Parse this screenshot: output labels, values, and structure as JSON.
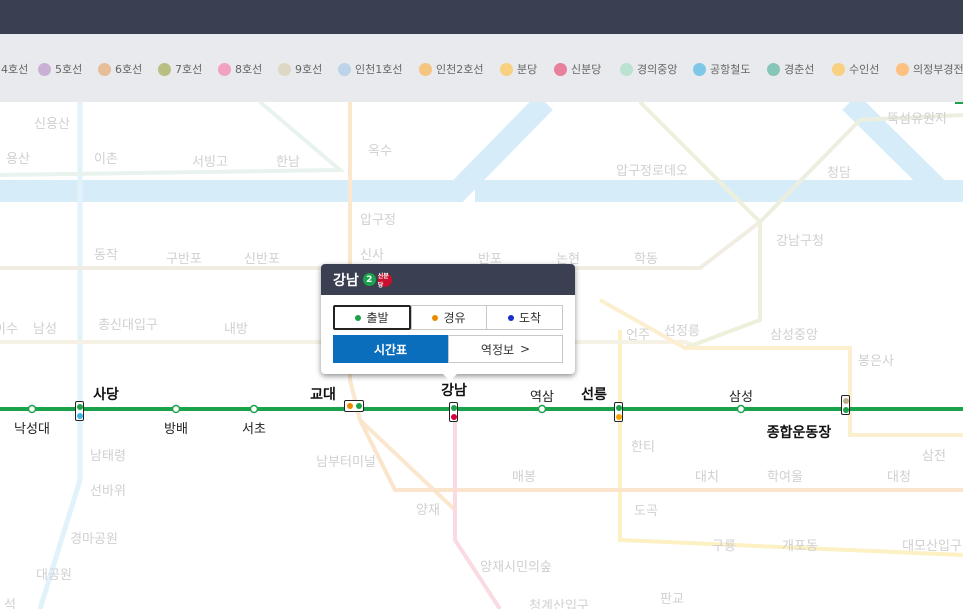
{
  "legend": [
    {
      "label": "4호선",
      "color": "#3cb4e5"
    },
    {
      "label": "5호선",
      "color": "#996cac",
      "num": "5"
    },
    {
      "label": "6호선",
      "color": "#cd7c2f",
      "num": "6"
    },
    {
      "label": "7호선",
      "color": "#747f00",
      "num": "7"
    },
    {
      "label": "8호선",
      "color": "#e6186c",
      "num": "8"
    },
    {
      "label": "9호선",
      "color": "#bdb092",
      "num": "9"
    },
    {
      "label": "인천1호선",
      "color": "#7ca8d5",
      "num": "I"
    },
    {
      "label": "인천2호선",
      "color": "#ed8b00",
      "num": "2"
    },
    {
      "label": "분당",
      "color": "#f5a200",
      "num": "분당"
    },
    {
      "label": "신분당",
      "color": "#d4003b",
      "num": "신분당"
    },
    {
      "label": "경의중앙",
      "color": "#77c4a3",
      "num": "경"
    },
    {
      "label": "공항철도",
      "color": "#0090d2",
      "num": "공"
    },
    {
      "label": "경춘선",
      "color": "#0c8e72",
      "num": "경"
    },
    {
      "label": "수인선",
      "color": "#f5a200",
      "num": "수"
    },
    {
      "label": "의정부경전",
      "color": "#fd8100",
      "num": "의"
    }
  ],
  "stations_faded": [
    {
      "name": "신용산"
    },
    {
      "name": "용산"
    },
    {
      "name": "이촌"
    },
    {
      "name": "서빙고"
    },
    {
      "name": "한남"
    },
    {
      "name": "옥수"
    },
    {
      "name": "압구정로데오"
    },
    {
      "name": "청담"
    },
    {
      "name": "뚝섬유원지"
    },
    {
      "name": "압구정"
    },
    {
      "name": "강남구청"
    },
    {
      "name": "동작"
    },
    {
      "name": "구반포"
    },
    {
      "name": "신반포"
    },
    {
      "name": "신사"
    },
    {
      "name": "반포"
    },
    {
      "name": "논현"
    },
    {
      "name": "학동"
    },
    {
      "name": "이수"
    },
    {
      "name": "남성"
    },
    {
      "name": "총신대입구"
    },
    {
      "name": "내방"
    },
    {
      "name": "언주"
    },
    {
      "name": "선정릉"
    },
    {
      "name": "삼성중앙"
    },
    {
      "name": "봉은사"
    },
    {
      "name": "남태령"
    },
    {
      "name": "선바위"
    },
    {
      "name": "경마공원"
    },
    {
      "name": "대공원"
    },
    {
      "name": "남부터미널"
    },
    {
      "name": "양재"
    },
    {
      "name": "양재시민의숲"
    },
    {
      "name": "청계산입구"
    },
    {
      "name": "매봉"
    },
    {
      "name": "한티"
    },
    {
      "name": "대치"
    },
    {
      "name": "학여울"
    },
    {
      "name": "대청"
    },
    {
      "name": "삼전"
    },
    {
      "name": "도곡"
    },
    {
      "name": "구룡"
    },
    {
      "name": "개포동"
    },
    {
      "name": "대모산입구"
    },
    {
      "name": "판교"
    },
    {
      "name": "석"
    }
  ],
  "line2_stations": [
    {
      "name": "낙성대"
    },
    {
      "name": "사당"
    },
    {
      "name": "방배"
    },
    {
      "name": "서초"
    },
    {
      "name": "교대"
    },
    {
      "name": "강남"
    },
    {
      "name": "역삼"
    },
    {
      "name": "선릉"
    },
    {
      "name": "삼성"
    },
    {
      "name": "종합운동장"
    }
  ],
  "popup": {
    "station": "강남",
    "line_badge": "2",
    "sinbundang_badge": "신분당",
    "departure": "출발",
    "via": "경유",
    "arrival": "도착",
    "timetable": "시간표",
    "station_info": "역정보",
    "chevron": ">"
  },
  "colors": {
    "line2": "#1aa34a",
    "header": "#3a3f52",
    "accent_blue": "#0a6ebd"
  }
}
